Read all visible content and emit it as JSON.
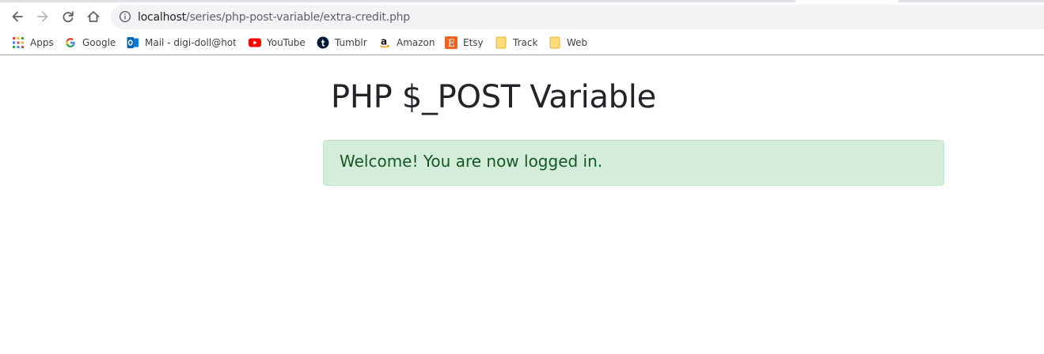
{
  "browser": {
    "address_bar": {
      "host": "localhost",
      "path": "/series/php-post-variable/extra-credit.php"
    },
    "nav": {
      "back_icon": "arrow-left-icon",
      "forward_icon": "arrow-right-icon",
      "reload_icon": "reload-icon",
      "home_icon": "home-icon"
    },
    "bookmarks": [
      {
        "label": "Apps",
        "icon": "apps-grid-icon"
      },
      {
        "label": "Google",
        "icon": "google-icon"
      },
      {
        "label": "Mail - digi-doll@hotr",
        "icon": "outlook-icon"
      },
      {
        "label": "YouTube",
        "icon": "youtube-icon"
      },
      {
        "label": "Tumblr",
        "icon": "tumblr-icon"
      },
      {
        "label": "Amazon",
        "icon": "amazon-icon"
      },
      {
        "label": "Etsy",
        "icon": "etsy-icon"
      },
      {
        "label": "Track",
        "icon": "folder-icon"
      },
      {
        "label": "Web",
        "icon": "folder-icon"
      }
    ]
  },
  "page": {
    "title": "PHP $_POST Variable",
    "alert": {
      "message": "Welcome! You are now logged in.",
      "background": "#d4edda",
      "border": "#c3e6cb",
      "text_color": "#155724"
    }
  }
}
